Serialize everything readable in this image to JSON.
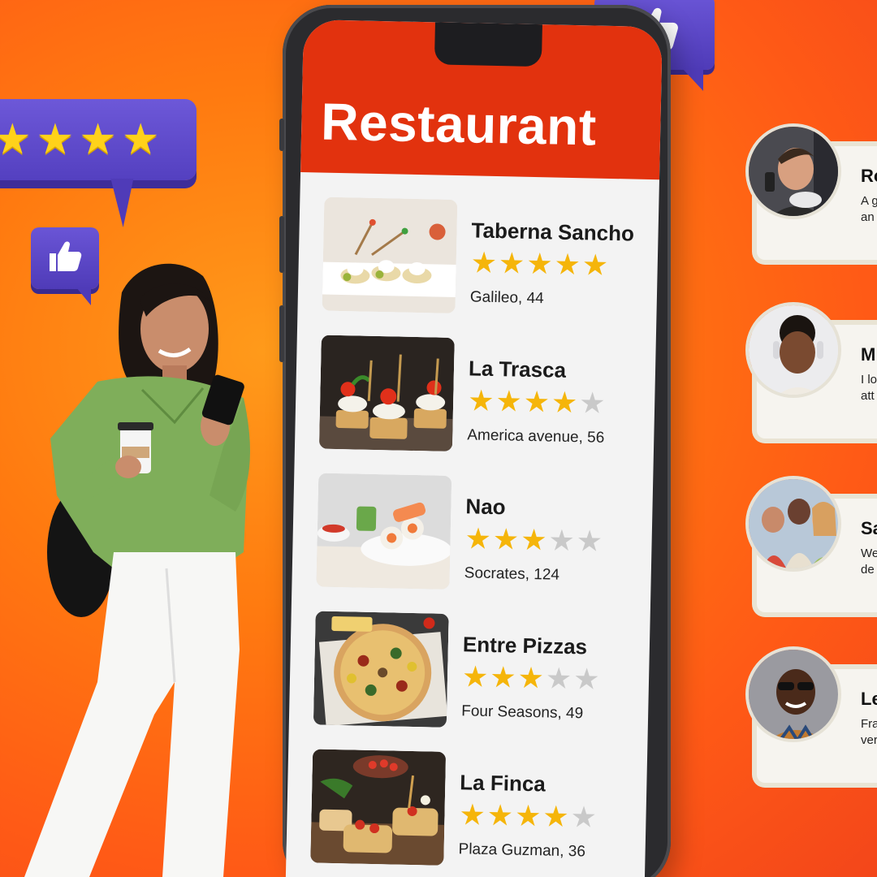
{
  "app": {
    "title": "Restaurant"
  },
  "rating_bubble": {
    "star_icon": "star-icon",
    "stars": 4
  },
  "thumbs": {
    "icon": "thumbs-up-icon"
  },
  "restaurants": [
    {
      "name": "Taberna Sancho",
      "rating": 5,
      "address": "Galileo, 44",
      "food": "canapes"
    },
    {
      "name": "La Trasca",
      "rating": 4,
      "address": "America avenue, 56",
      "food": "tomato-skewers"
    },
    {
      "name": "Nao",
      "rating": 3,
      "address": "Socrates, 124",
      "food": "sushi"
    },
    {
      "name": "Entre Pizzas",
      "rating": 3,
      "address": "Four Seasons, 49",
      "food": "pizza"
    },
    {
      "name": "La Finca",
      "rating": 4,
      "address": "Plaza Guzman, 36",
      "food": "bruschetta"
    }
  ],
  "reviews": [
    {
      "name": "Ro",
      "line1": "A g",
      "line2": "an"
    },
    {
      "name": "M",
      "line1": "I lo",
      "line2": "att"
    },
    {
      "name": "Sa",
      "line1": "We",
      "line2": "de"
    },
    {
      "name": "Le",
      "line1": "Fra",
      "line2": "ver"
    }
  ],
  "colors": {
    "accent": "#e2320e",
    "star": "#f5b50a",
    "bubble": "#5a45c9",
    "background": "#ff7a10"
  }
}
